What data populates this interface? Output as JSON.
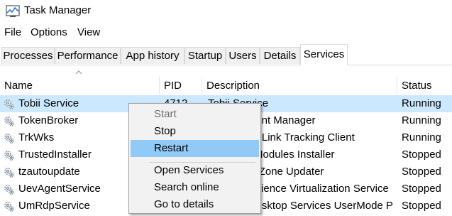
{
  "window": {
    "title": "Task Manager",
    "icon": "task-manager-icon"
  },
  "menu": [
    "File",
    "Options",
    "View"
  ],
  "tabs": [
    {
      "label": "Processes"
    },
    {
      "label": "Performance"
    },
    {
      "label": "App history"
    },
    {
      "label": "Startup"
    },
    {
      "label": "Users"
    },
    {
      "label": "Details"
    },
    {
      "label": "Services",
      "active": true
    }
  ],
  "columns": {
    "name": "Name",
    "pid": "PID",
    "description": "Description",
    "status": "Status"
  },
  "rows": [
    {
      "name": "Tobii Service",
      "pid": "4712",
      "description": "Tobii Service",
      "status": "Running",
      "selected": true
    },
    {
      "name": "TokenBroker",
      "pid": "",
      "description": "Web Account Manager",
      "status": "Running"
    },
    {
      "name": "TrkWks",
      "pid": "",
      "description": "Distributed Link Tracking Client",
      "status": "Running"
    },
    {
      "name": "TrustedInstaller",
      "pid": "",
      "description": "Windows Modules Installer",
      "status": "Stopped"
    },
    {
      "name": "tzautoupdate",
      "pid": "",
      "description": "Auto Time Zone Updater",
      "status": "Stopped"
    },
    {
      "name": "UevAgentService",
      "pid": "",
      "description": "User Experience Virtualization Service",
      "status": "Stopped"
    },
    {
      "name": "UmRdpService",
      "pid": "",
      "description": "Remote Desktop Services UserMode Port Redirector",
      "status": "Stopped"
    }
  ],
  "context_menu": {
    "items": [
      {
        "label": "Start",
        "disabled": true
      },
      {
        "label": "Stop"
      },
      {
        "label": "Restart",
        "highlighted": true
      },
      {
        "label": "Open Services"
      },
      {
        "label": "Search online"
      },
      {
        "label": "Go to details"
      }
    ]
  },
  "colors": {
    "selected_row": "#cce8ff",
    "menu_highlight": "#91c9f7"
  }
}
